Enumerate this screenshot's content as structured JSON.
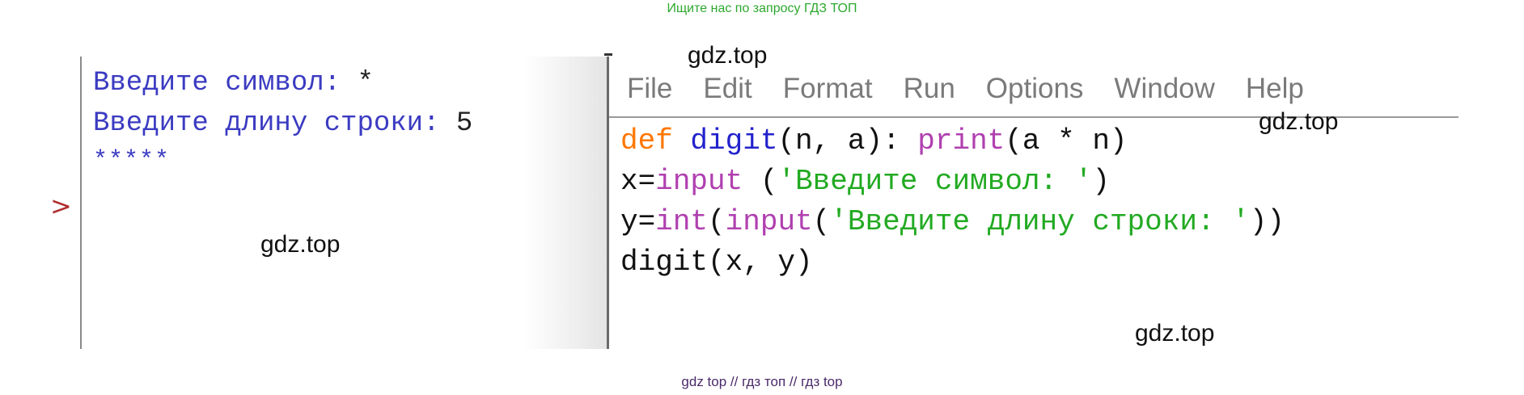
{
  "banner": "Ищите нас по запросу ГДЗ ТОП",
  "shell": {
    "line1_label": "Введите символ: ",
    "line1_value": "*",
    "line2_label": "Введите длину строки: ",
    "line2_value": "5",
    "output": "*****",
    "prompt": ">"
  },
  "editor": {
    "menu": [
      "File",
      "Edit",
      "Format",
      "Run",
      "Options",
      "Window",
      "Help"
    ],
    "code": {
      "l1_def": "def",
      "l1_name": " digit",
      "l1_args": "(n, a): ",
      "l1_print": "print",
      "l1_rest": "(a * n)",
      "l2_pre": "x=",
      "l2_input": "input",
      "l2_mid": " (",
      "l2_str": "'Введите символ: '",
      "l2_end": ")",
      "l3_pre": "y=",
      "l3_int": "int",
      "l3_paren": "(",
      "l3_input": "input",
      "l3_paren2": "(",
      "l3_str": "'Введите длину строки: '",
      "l3_end": "))",
      "l4": "digit(x, y)"
    }
  },
  "watermarks": [
    "gdz.top",
    "gdz.top",
    "gdz.top",
    "gdz.top"
  ],
  "footer": "gdz top  //  гдз топ  //  гдз top"
}
